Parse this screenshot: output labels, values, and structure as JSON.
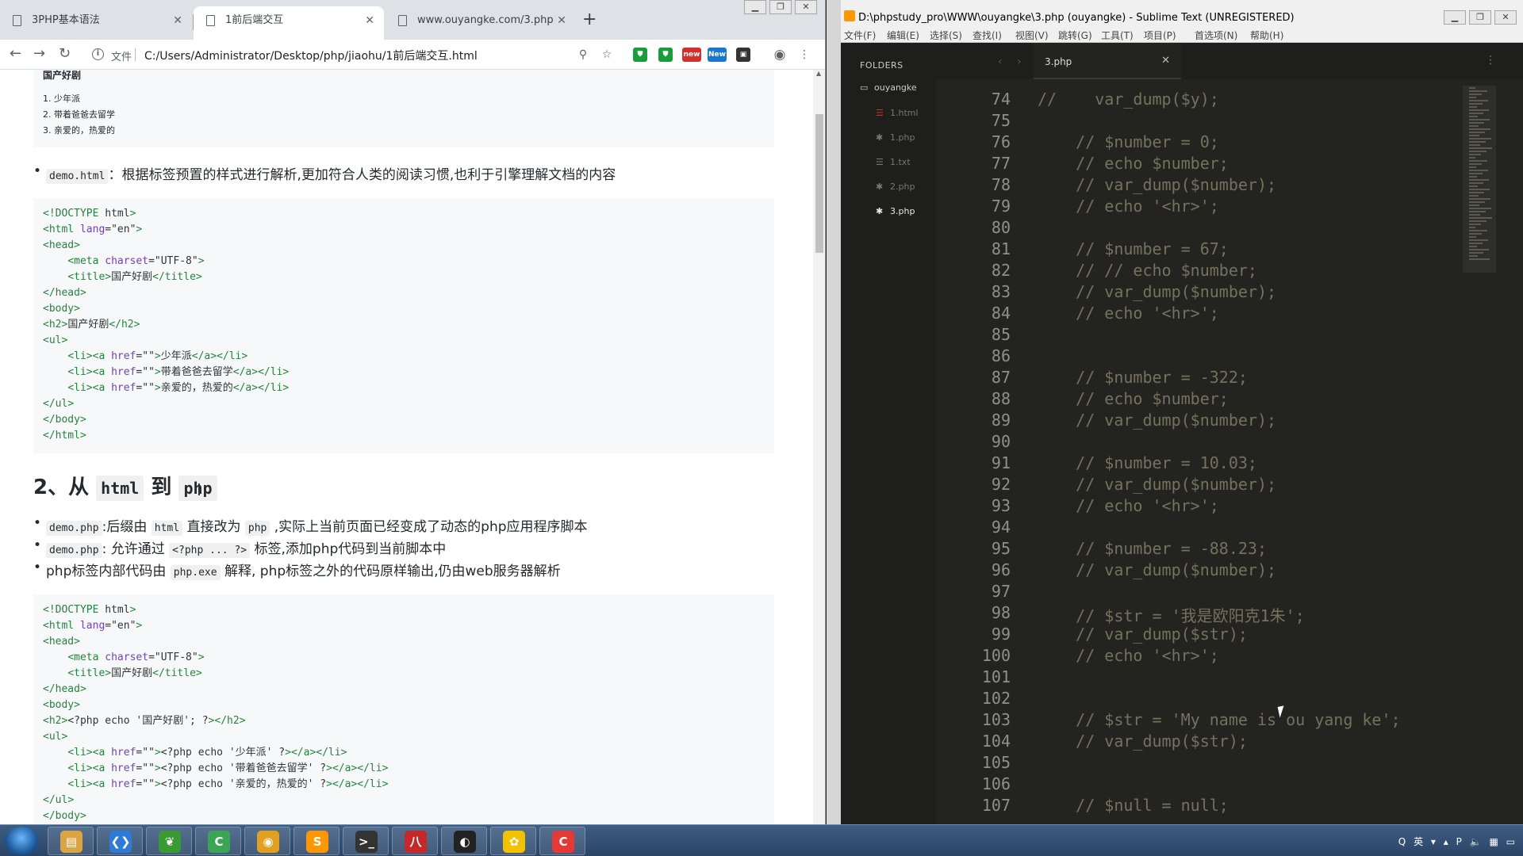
{
  "browser": {
    "tabs": [
      {
        "label": "3PHP基本语法"
      },
      {
        "label": "1前后端交互"
      },
      {
        "label": "www.ouyangke.com/3.php"
      }
    ],
    "new_tab": "+",
    "file_label": "文件",
    "url": "C:/Users/Administrator/Desktop/php/jiaohu/1前后端交互.html",
    "ext_new1": "new",
    "ext_new2": "New",
    "page": {
      "top_block": {
        "heading": "国产好剧",
        "items": [
          "1. 少年派",
          "2. 带着爸爸去留学",
          "3. 亲爱的，热爱的"
        ]
      },
      "bullet1": {
        "code": "demo.html",
        "text": "：根据标签预置的样式进行解析,更加符合人类的阅读习惯,也利于引擎理解文档的内容"
      },
      "code1": [
        "<!DOCTYPE html>",
        "<html lang=\"en\">",
        "<head>",
        "    <meta charset=\"UTF-8\">",
        "    <title>国产好剧</title>",
        "</head>",
        "<body>",
        "<h2>国产好剧</h2>",
        "<ul>",
        "    <li><a href=\"\">少年派</a></li>",
        "    <li><a href=\"\">带着爸爸去留学</a></li>",
        "    <li><a href=\"\">亲爱的，热爱的</a></li>",
        "</ul>",
        "</body>",
        "</html>"
      ],
      "section_heading": {
        "prefix": "2、从 ",
        "code1": "html",
        "mid": " 到 ",
        "code2": "php"
      },
      "bullet2": {
        "code": "demo.php",
        "text_a": ":后缀由 ",
        "code_b": "html",
        "text_c": " 直接改为 ",
        "code_d": "php",
        "text_e": " ,实际上当前页面已经变成了动态的php应用程序脚本"
      },
      "bullet3": {
        "code": "demo.php",
        "text_a": ": 允许通过 ",
        "code_b": "<?php ... ?>",
        "text_c": " 标签,添加php代码到当前脚本中"
      },
      "bullet4": {
        "text_a": "php标签内部代码由 ",
        "code_b": "php.exe",
        "text_c": " 解释, php标签之外的代码原样输出,仍由web服务器解析"
      },
      "code2": [
        "<!DOCTYPE html>",
        "<html lang=\"en\">",
        "<head>",
        "    <meta charset=\"UTF-8\">",
        "    <title>国产好剧</title>",
        "</head>",
        "<body>",
        "<h2><?php echo '国产好剧'; ?></h2>",
        "<ul>",
        "    <li><a href=\"\"><?php echo '少年派' ?></a></li>",
        "    <li><a href=\"\"><?php echo '带着爸爸去留学' ?></a></li>",
        "    <li><a href=\"\"><?php echo '亲爱的，热爱的' ?></a></li>",
        "</ul>",
        "</body>"
      ]
    }
  },
  "sublime": {
    "title": "D:\\phpstudy_pro\\WWW\\ouyangke\\3.php (ouyangke) - Sublime Text (UNREGISTERED)",
    "menu": [
      "文件(F)",
      "编辑(E)",
      "选择(S)",
      "查找(I)",
      "视图(V)",
      "跳转(G)",
      "工具(T)",
      "项目(P)",
      "首选项(N)",
      "帮助(H)"
    ],
    "folders_label": "FOLDERS",
    "folder": "ouyangke",
    "files": [
      "1.html",
      "1.php",
      "1.txt",
      "2.php",
      "3.php"
    ],
    "active_tab": "3.php",
    "lines": [
      {
        "n": "74",
        "t": "//    var_dump($y);"
      },
      {
        "n": "75",
        "t": ""
      },
      {
        "n": "76",
        "t": "    // $number = 0;"
      },
      {
        "n": "77",
        "t": "    // echo $number;"
      },
      {
        "n": "78",
        "t": "    // var_dump($number);"
      },
      {
        "n": "79",
        "t": "    // echo '<hr>';"
      },
      {
        "n": "80",
        "t": ""
      },
      {
        "n": "81",
        "t": "    // $number = 67;"
      },
      {
        "n": "82",
        "t": "    // // echo $number;"
      },
      {
        "n": "83",
        "t": "    // var_dump($number);"
      },
      {
        "n": "84",
        "t": "    // echo '<hr>';"
      },
      {
        "n": "85",
        "t": ""
      },
      {
        "n": "86",
        "t": ""
      },
      {
        "n": "87",
        "t": "    // $number = -322;"
      },
      {
        "n": "88",
        "t": "    // echo $number;"
      },
      {
        "n": "89",
        "t": "    // var_dump($number);"
      },
      {
        "n": "90",
        "t": ""
      },
      {
        "n": "91",
        "t": "    // $number = 10.03;"
      },
      {
        "n": "92",
        "t": "    // var_dump($number);"
      },
      {
        "n": "93",
        "t": "    // echo '<hr>';"
      },
      {
        "n": "94",
        "t": ""
      },
      {
        "n": "95",
        "t": "    // $number = -88.23;"
      },
      {
        "n": "96",
        "t": "    // var_dump($number);"
      },
      {
        "n": "97",
        "t": ""
      },
      {
        "n": "98",
        "t": "    // $str = '我是欧阳克1朱';"
      },
      {
        "n": "99",
        "t": "    // var_dump($str);"
      },
      {
        "n": "100",
        "t": "    // echo '<hr>';"
      },
      {
        "n": "101",
        "t": ""
      },
      {
        "n": "102",
        "t": ""
      },
      {
        "n": "103",
        "t": "    // $str = 'My name is ou yang ke';"
      },
      {
        "n": "104",
        "t": "    // var_dump($str);"
      },
      {
        "n": "105",
        "t": ""
      },
      {
        "n": "106",
        "t": ""
      },
      {
        "n": "107",
        "t": "    // $null = null;"
      }
    ]
  },
  "taskbar": {
    "apps": [
      {
        "name": "explorer",
        "color": "#d9a441",
        "glyph": "▤"
      },
      {
        "name": "kodi-like",
        "color": "#2d7bd6",
        "glyph": "❮❯"
      },
      {
        "name": "leaf",
        "color": "#3a9b35",
        "glyph": "❦"
      },
      {
        "name": "c-green",
        "color": "#3aa655",
        "glyph": "C"
      },
      {
        "name": "chrome",
        "color": "#e0a020",
        "glyph": "◉"
      },
      {
        "name": "sublime",
        "color": "#ff9800",
        "glyph": "S"
      },
      {
        "name": "terminal",
        "color": "#333333",
        "glyph": ">_"
      },
      {
        "name": "badge",
        "color": "#c62828",
        "glyph": "八"
      },
      {
        "name": "obs",
        "color": "#222222",
        "glyph": "◐"
      },
      {
        "name": "snail",
        "color": "#f2c200",
        "glyph": "✿"
      },
      {
        "name": "c-red",
        "color": "#e53935",
        "glyph": "C"
      }
    ],
    "tray_ime": "英"
  }
}
